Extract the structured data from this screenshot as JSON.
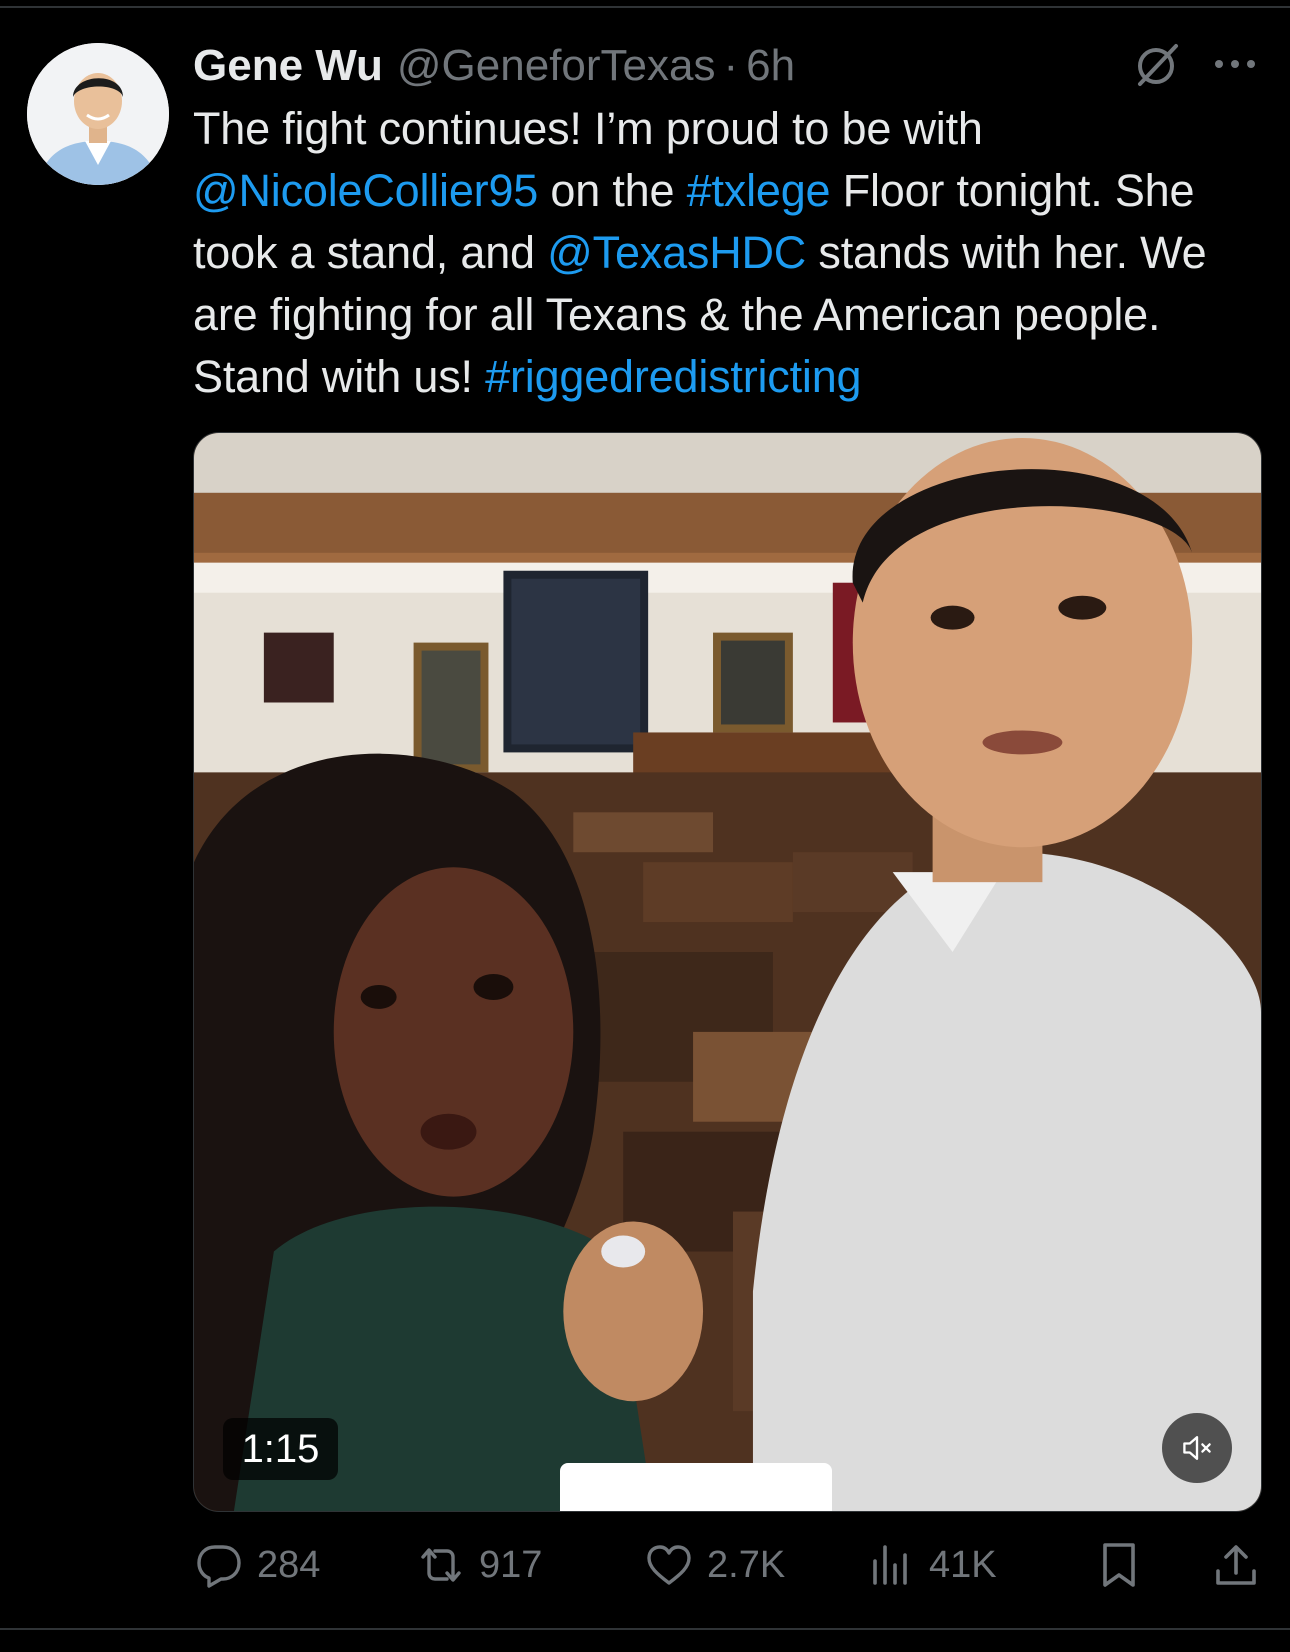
{
  "post": {
    "author": {
      "display_name": "Gene Wu",
      "handle": "@GeneforTexas",
      "separator": "·",
      "time": "6h"
    },
    "text_segments": [
      {
        "text": "The fight continues! I’m proud to be with ",
        "type": "text"
      },
      {
        "text": "@NicoleCollier95",
        "type": "mention"
      },
      {
        "text": " on the ",
        "type": "text"
      },
      {
        "text": "#txlege",
        "type": "hashtag"
      },
      {
        "text": " Floor tonight. She took a stand, and ",
        "type": "text"
      },
      {
        "text": "@TexasHDC",
        "type": "mention"
      },
      {
        "text": " stands with her. We are fighting for all Texans & the American people. Stand with us! ",
        "type": "text"
      },
      {
        "text": "#riggedredistricting",
        "type": "hashtag"
      }
    ],
    "media": {
      "kind": "video",
      "duration": "1:15",
      "muted": true
    },
    "metrics": {
      "replies": "284",
      "reposts": "917",
      "likes": "2.7K",
      "views": "41K"
    },
    "icons": [
      "grok-icon",
      "more-icon",
      "reply-icon",
      "repost-icon",
      "like-icon",
      "views-icon",
      "bookmark-icon",
      "share-icon",
      "mute-icon"
    ]
  },
  "colors": {
    "background": "#000000",
    "text": "#e7e9ea",
    "secondary": "#71767b",
    "link": "#1d9bf0",
    "divider": "#2f3336"
  }
}
